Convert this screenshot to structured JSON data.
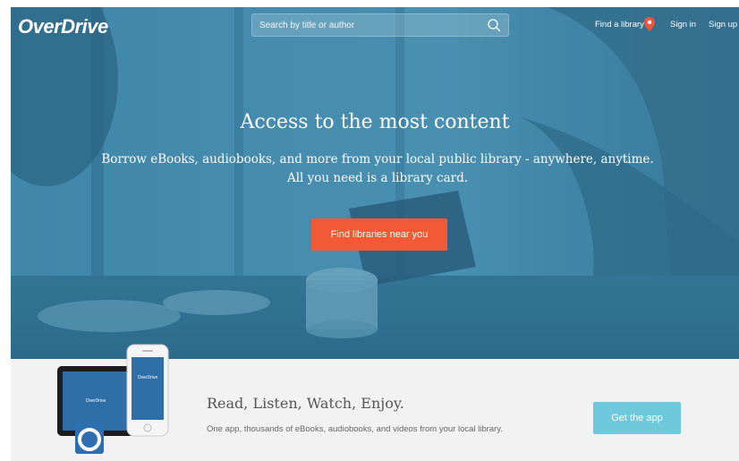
{
  "header": {
    "logo_text": "OverDrive",
    "search": {
      "placeholder": "Search by title or author",
      "value": "",
      "icon": "search-icon"
    },
    "find_library_label": "Find a library",
    "find_library_icon": "map-pin-icon",
    "sign_in_label": "Sign in",
    "sign_up_label": "Sign up"
  },
  "hero": {
    "title": "Access to the most content",
    "subtitle": "Borrow eBooks, audiobooks, and more from your local public library - anywhere, anytime. All you need is a library card.",
    "cta_label": "Find libraries near you"
  },
  "app_promo": {
    "title": "Read, Listen, Watch, Enjoy.",
    "subtitle": "One app, thousands of eBooks, audiobooks, and videos from your local library.",
    "button_label": "Get the app",
    "device_brand_tablet": "OverDrive",
    "device_brand_phone": "OverDrive"
  },
  "colors": {
    "cta_orange": "#f15a34",
    "app_button_blue": "#6fc9dd",
    "pin_orange": "#f0543a",
    "hero_tint": "#3e7fa0",
    "strip_bg": "#f2f2f2"
  }
}
